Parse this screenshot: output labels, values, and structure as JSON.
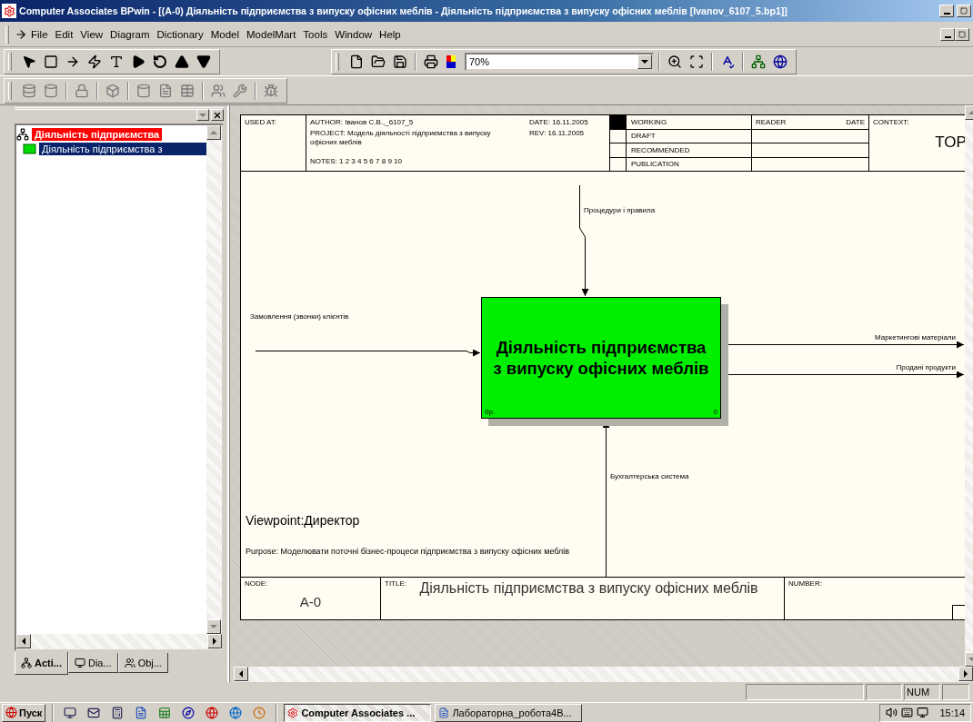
{
  "window": {
    "title": "Computer Associates BPwin - [(A-0) Діяльність підприємства  з випуску офісних меблів - Діяльність підприємства з випуску офісних меблів  [Ivanov_6107_5.bp1]]"
  },
  "menu": [
    "File",
    "Edit",
    "View",
    "Diagram",
    "Dictionary",
    "Model",
    "ModelMart",
    "Tools",
    "Window",
    "Help"
  ],
  "toolbar": {
    "zoom": "70%"
  },
  "explorer": {
    "tree": [
      {
        "label": "Діяльність підприємства",
        "selected": false,
        "children": [
          {
            "label": "Діяльність підприємства  з",
            "selected": true
          }
        ]
      }
    ],
    "tabs": [
      {
        "label": "Acti...",
        "selected": true
      },
      {
        "label": "Dia...",
        "selected": false
      },
      {
        "label": "Obj...",
        "selected": false
      }
    ]
  },
  "diagram": {
    "header": {
      "used_at": "USED AT:",
      "author": "AUTHOR:  Іванов С.В.,_6107_5",
      "project": "PROJECT:  Модель діяльності підприємства з випуску офісних меблів",
      "notes": "NOTES:  1  2  3  4  5  6  7  8  9  10",
      "date": "DATE:  16.11.2005",
      "rev": "REV:   16.11.2005",
      "statuses": [
        {
          "label": "WORKING",
          "selected": true
        },
        {
          "label": "DRAFT",
          "selected": false
        },
        {
          "label": "RECOMMENDED",
          "selected": false
        },
        {
          "label": "PUBLICATION",
          "selected": false
        }
      ],
      "reader": "READER",
      "reader_date": "DATE",
      "context_label": "CONTEXT:",
      "context": "TOP"
    },
    "activity": {
      "name": "Діяльність підприємства з випуску офісних меблів",
      "cost": "0р.",
      "number": "0"
    },
    "arrows": [
      {
        "kind": "control",
        "label": "Процедури і правила"
      },
      {
        "kind": "input",
        "label": "Замовлення (звонки) клієнтів"
      },
      {
        "kind": "output",
        "label": "Маркетингові матеріали"
      },
      {
        "kind": "output",
        "label": "Продані продукти"
      },
      {
        "kind": "mechanism",
        "label": "Бухгалтерська система"
      }
    ],
    "viewpoint": "Viewpoint:Директор",
    "purpose": "Purpose: Моделювати поточні бізнес-процеси підприємства з випуску офісних меблів",
    "footer": {
      "node_label": "NODE:",
      "node": "A-0",
      "title_label": "TITLE:",
      "title": "Діяльність підприємства  з випуску офісних меблів",
      "number_label": "NUMBER:"
    }
  },
  "status_bar": {
    "indicator": "NUM"
  },
  "taskbar": {
    "start": "Пуск",
    "tasks": [
      {
        "label": "Computer Associates ...",
        "selected": true
      },
      {
        "label": "Лабораторна_робота4В...",
        "selected": false
      }
    ],
    "clock": "15:14"
  }
}
